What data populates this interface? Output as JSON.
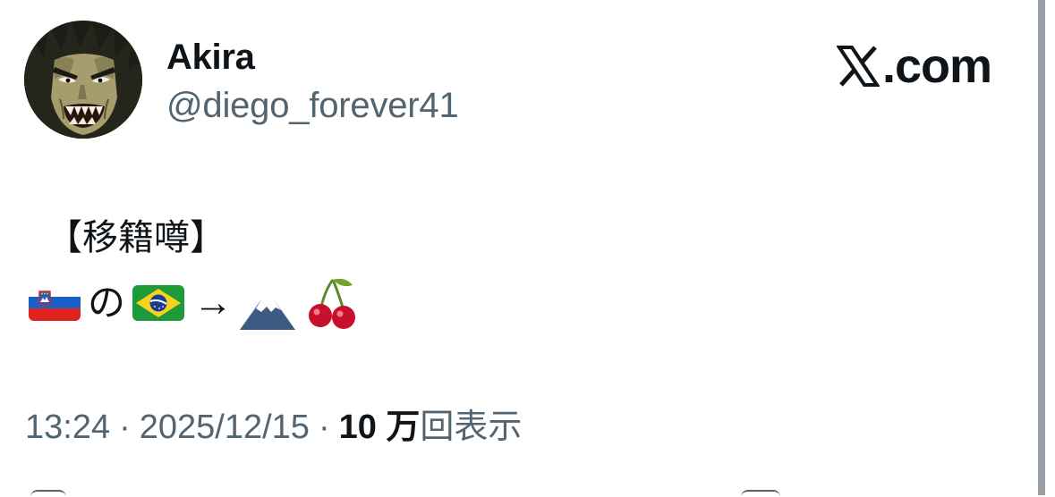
{
  "author": {
    "display_name": "Akira",
    "handle": "@diego_forever41"
  },
  "brand": {
    "text": ".com",
    "icon": "x-logo-icon"
  },
  "tweet": {
    "title": "【移籍噂】",
    "line_items": [
      {
        "type": "emoji",
        "icon": "slovenia-flag-icon"
      },
      {
        "type": "text",
        "value": "の"
      },
      {
        "type": "emoji",
        "icon": "brazil-flag-icon"
      },
      {
        "type": "text",
        "value": "→"
      },
      {
        "type": "emoji",
        "icon": "mount-fuji-icon"
      },
      {
        "type": "emoji",
        "icon": "cherries-icon"
      }
    ],
    "particle": "の",
    "arrow": "→"
  },
  "meta": {
    "time": "13:24",
    "separator": "·",
    "date": "2025/12/15",
    "views_count": "10 万",
    "views_label": "回表示"
  },
  "colors": {
    "text_primary": "#0f1419",
    "text_secondary": "#536471",
    "background": "#ffffff"
  }
}
